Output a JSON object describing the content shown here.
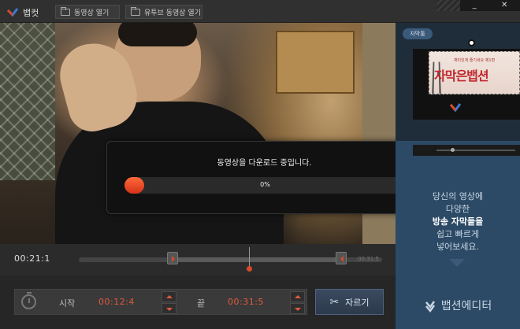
{
  "app": {
    "title": "뱁컷",
    "open_video_label": "동영상 열기",
    "open_youtube_label": "유투브 동영상 열기",
    "window_controls": {
      "minimize": "_",
      "close": "✕"
    }
  },
  "download_dialog": {
    "message": "동영상을 다운로드 중입니다.",
    "progress_percent": 0,
    "progress_text": "0%",
    "close_label": "✕"
  },
  "timeline": {
    "current_time": "00:21:1",
    "total_time": "00:31:5"
  },
  "controls": {
    "start_label": "시작",
    "start_time": "00:12:4",
    "end_label": "끝",
    "end_time": "00:31:5",
    "cut_label": "자르기"
  },
  "ad": {
    "subtitle_tag": "자막툴",
    "sample_small_text": "재미있게 즐기세요 제1편",
    "sample_big_text": "자막은뱁션",
    "text_lines": [
      "당신의 영상에",
      "다양한",
      "방송 자막들을",
      "쉽고 빠르게",
      "넣어보세요."
    ],
    "brand_name": "뱁션에디터"
  },
  "colors": {
    "accent_red": "#e05a3a",
    "panel_blue": "#2c4a66",
    "cut_button": "#3b4a60"
  }
}
